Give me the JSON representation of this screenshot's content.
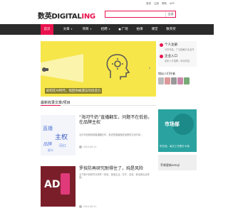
{
  "header": {
    "logo_cn": "数英",
    "logo_en": "DIGITAL",
    "logo_ing": "ING",
    "search_button": "全部",
    "top_links": [
      "登录",
      "注册",
      "帮助",
      "APP"
    ]
  },
  "nav": {
    "items": [
      {
        "label": "首页",
        "active": true
      },
      {
        "label": "文章",
        "has_dropdown": true
      },
      {
        "label": "项目",
        "has_dropdown": true
      },
      {
        "label": "招聘",
        "has_dropdown": true
      },
      {
        "label": "广场",
        "has_icon": true
      },
      {
        "label": "拍课"
      },
      {
        "label": "课堂"
      },
      {
        "label": "数英奖"
      }
    ]
  },
  "banner": {
    "caption": "如何在AI时代，找回你被遗忘的创造力"
  },
  "sidebar": {
    "boxes": [
      {
        "title": "个人注册",
        "sub": "分享作品，广泛接触行业合作"
      },
      {
        "title": "企业入口",
        "sub": "发布人才招聘，申请内容"
      }
    ],
    "people_heading": "相似人们作者"
  },
  "list": {
    "section_title": "最新收录文章/项目",
    "articles": [
      {
        "headline": "“海河牛奶”直播翻车，问题不在低俗，在品牌主权",
        "summary": "当中市品牌营销直播翻红时，就说把直播做成品牌的文化时间…",
        "date": "2024-06-11",
        "thumb_words": [
          "直播",
          "主权",
          "品牌",
          "网红",
          "翻车"
        ]
      },
      {
        "headline": "罗技防再研究耐得住了，纯是风险",
        "summary": "当下新兴的研究与研究一些电，营造生活，打开、讲述、新动看出这样回…",
        "date": "2024-06-11",
        "thumb_words": [
          "AD"
        ]
      }
    ]
  },
  "ads": {
    "market_title": "市场部",
    "market_sub": "吃东西、每天工作是什么味",
    "emoji_title": "苹果更新emoji"
  },
  "colors": {
    "brand_red": "#e8114d",
    "nav_dark": "#2b2b2b",
    "banner_yellow": "#f6e64a",
    "ad_teal": "#2aa3a0"
  }
}
